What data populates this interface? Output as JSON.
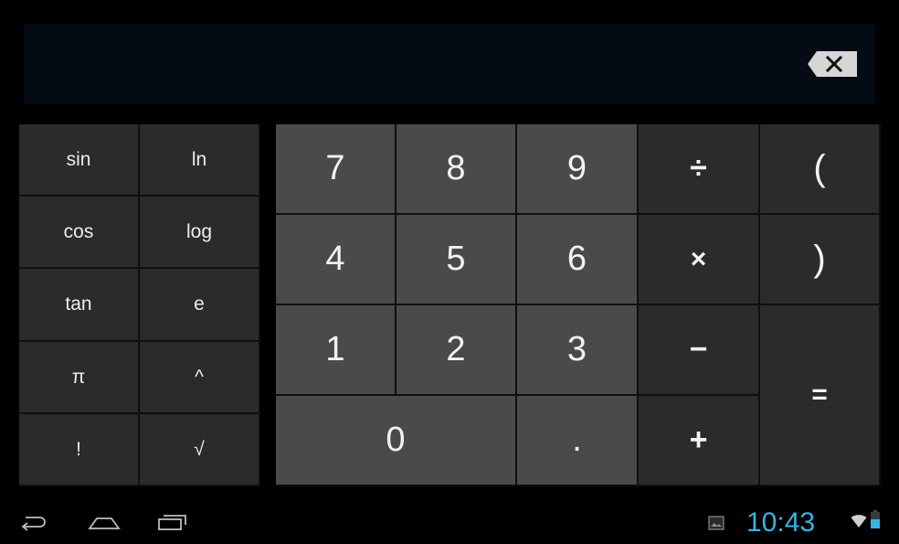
{
  "display": {
    "expression": "",
    "backspace_icon": "backspace-icon"
  },
  "advanced_keys": [
    {
      "label": "sin"
    },
    {
      "label": "ln"
    },
    {
      "label": "cos"
    },
    {
      "label": "log"
    },
    {
      "label": "tan"
    },
    {
      "label": "e"
    },
    {
      "label": "π"
    },
    {
      "label": "^"
    },
    {
      "label": "!"
    },
    {
      "label": "√"
    }
  ],
  "keys": {
    "k7": "7",
    "k8": "8",
    "k9": "9",
    "k4": "4",
    "k5": "5",
    "k6": "6",
    "k1": "1",
    "k2": "2",
    "k3": "3",
    "k0": "0",
    "dot": ".",
    "divide": "÷",
    "multiply": "×",
    "minus": "−",
    "plus": "+",
    "open_paren": "(",
    "close_paren": ")",
    "equals": "="
  },
  "status_bar": {
    "time": "10:43",
    "icons": [
      "back-icon",
      "home-icon",
      "recent-apps-icon",
      "screenshot-icon",
      "wifi-icon",
      "battery-icon"
    ]
  },
  "colors": {
    "display_bg": "#030b14",
    "number_key": "#4a4a4a",
    "function_key": "#2b2b2b",
    "clock": "#33b5e5"
  }
}
